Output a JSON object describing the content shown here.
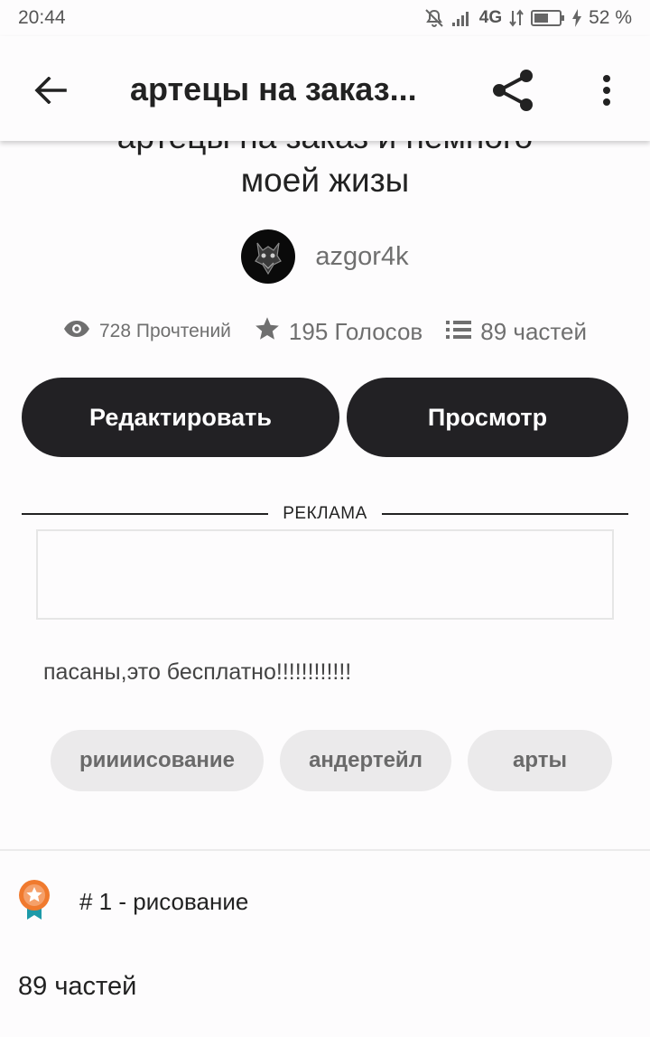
{
  "status_bar": {
    "time": "20:44",
    "network": "4G",
    "battery": "52 %"
  },
  "app_bar": {
    "title": "артецы на заказ..."
  },
  "story": {
    "title_line1": "артецы на заказ  и немного",
    "title_line2": "моей жизы",
    "author": "azgor4k",
    "stats": {
      "reads": "728 Прочтений",
      "votes": "195 Голосов",
      "parts": "89 частей"
    },
    "description": "пасаны,это бесплатно!!!!!!!!!!!!"
  },
  "actions": {
    "edit_label": "Редактировать",
    "view_label": "Просмотр"
  },
  "ad": {
    "label": "РЕКЛАМА"
  },
  "tags": [
    "риииисование",
    "андертейл",
    "арты"
  ],
  "ranking": {
    "text": "# 1 - рисование"
  },
  "parts_section": {
    "title": "89 частей"
  },
  "colors": {
    "button_bg": "#222124",
    "tag_bg": "#ebeaeb",
    "badge_orange": "#f07a2e",
    "badge_teal": "#1d9aa8"
  }
}
